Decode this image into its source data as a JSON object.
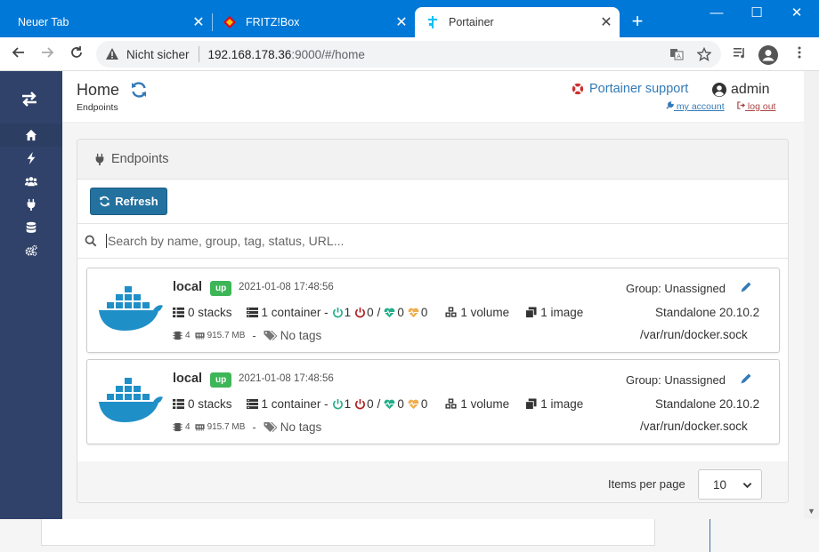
{
  "browser": {
    "tabs": [
      {
        "title": "Neuer Tab",
        "active": false
      },
      {
        "title": "FRITZ!Box",
        "active": false
      },
      {
        "title": "Portainer",
        "active": true
      }
    ],
    "new_tab": "+",
    "window_controls": {
      "minimize": "—",
      "maximize": "☐",
      "close": "✕"
    },
    "address": {
      "security_label": "Nicht sicher",
      "host": "192.168.178.36",
      "path": ":9000/#/home"
    }
  },
  "sidebar": {
    "items": [
      {
        "icon": "home-icon",
        "active": true
      },
      {
        "icon": "bolt-icon",
        "active": false
      },
      {
        "icon": "users-icon",
        "active": false
      },
      {
        "icon": "plug-icon",
        "active": false
      },
      {
        "icon": "database-icon",
        "active": false
      },
      {
        "icon": "cogs-icon",
        "active": false
      }
    ]
  },
  "header": {
    "title": "Home",
    "breadcrumb": "Endpoints",
    "support_label": "Portainer support",
    "username": "admin",
    "my_account": "my account",
    "log_out": "log out"
  },
  "endpoints_widget": {
    "title": "Endpoints",
    "refresh_label": "Refresh",
    "search_placeholder": "Search by name, group, tag, status, URL...",
    "items_per_page_label": "Items per page",
    "items_per_page_value": "10",
    "endpoints": [
      {
        "name": "local",
        "status": "up",
        "timestamp": "2021-01-08 17:48:56",
        "group": "Group: Unassigned",
        "stacks": "0 stacks",
        "containers": "1 container -",
        "running": "1",
        "stopped": "0",
        "separator": "/",
        "healthy": "0",
        "unhealthy": "0",
        "volumes": "1 volume",
        "images": "1 image",
        "engine": "Standalone 20.10.2",
        "cpu": "4",
        "memory": "915.7 MB",
        "dash": "-",
        "tags": "No tags",
        "url": "/var/run/docker.sock"
      },
      {
        "name": "local",
        "status": "up",
        "timestamp": "2021-01-08 17:48:56",
        "group": "Group: Unassigned",
        "stacks": "0 stacks",
        "containers": "1 container -",
        "running": "1",
        "stopped": "0",
        "separator": "/",
        "healthy": "0",
        "unhealthy": "0",
        "volumes": "1 volume",
        "images": "1 image",
        "engine": "Standalone 20.10.2",
        "cpu": "4",
        "memory": "915.7 MB",
        "dash": "-",
        "tags": "No tags",
        "url": "/var/run/docker.sock"
      }
    ]
  },
  "colors": {
    "tabstrip": "#0078d7",
    "sidebar": "#30426a",
    "primary_button": "#23719f",
    "status_up": "#3db657",
    "link": "#337ab7",
    "logout": "#a94442",
    "docker_blue": "#1f8fc7",
    "running": "#23ae89",
    "stopped": "#ae2323",
    "unhealthy": "#f0ad4e"
  }
}
